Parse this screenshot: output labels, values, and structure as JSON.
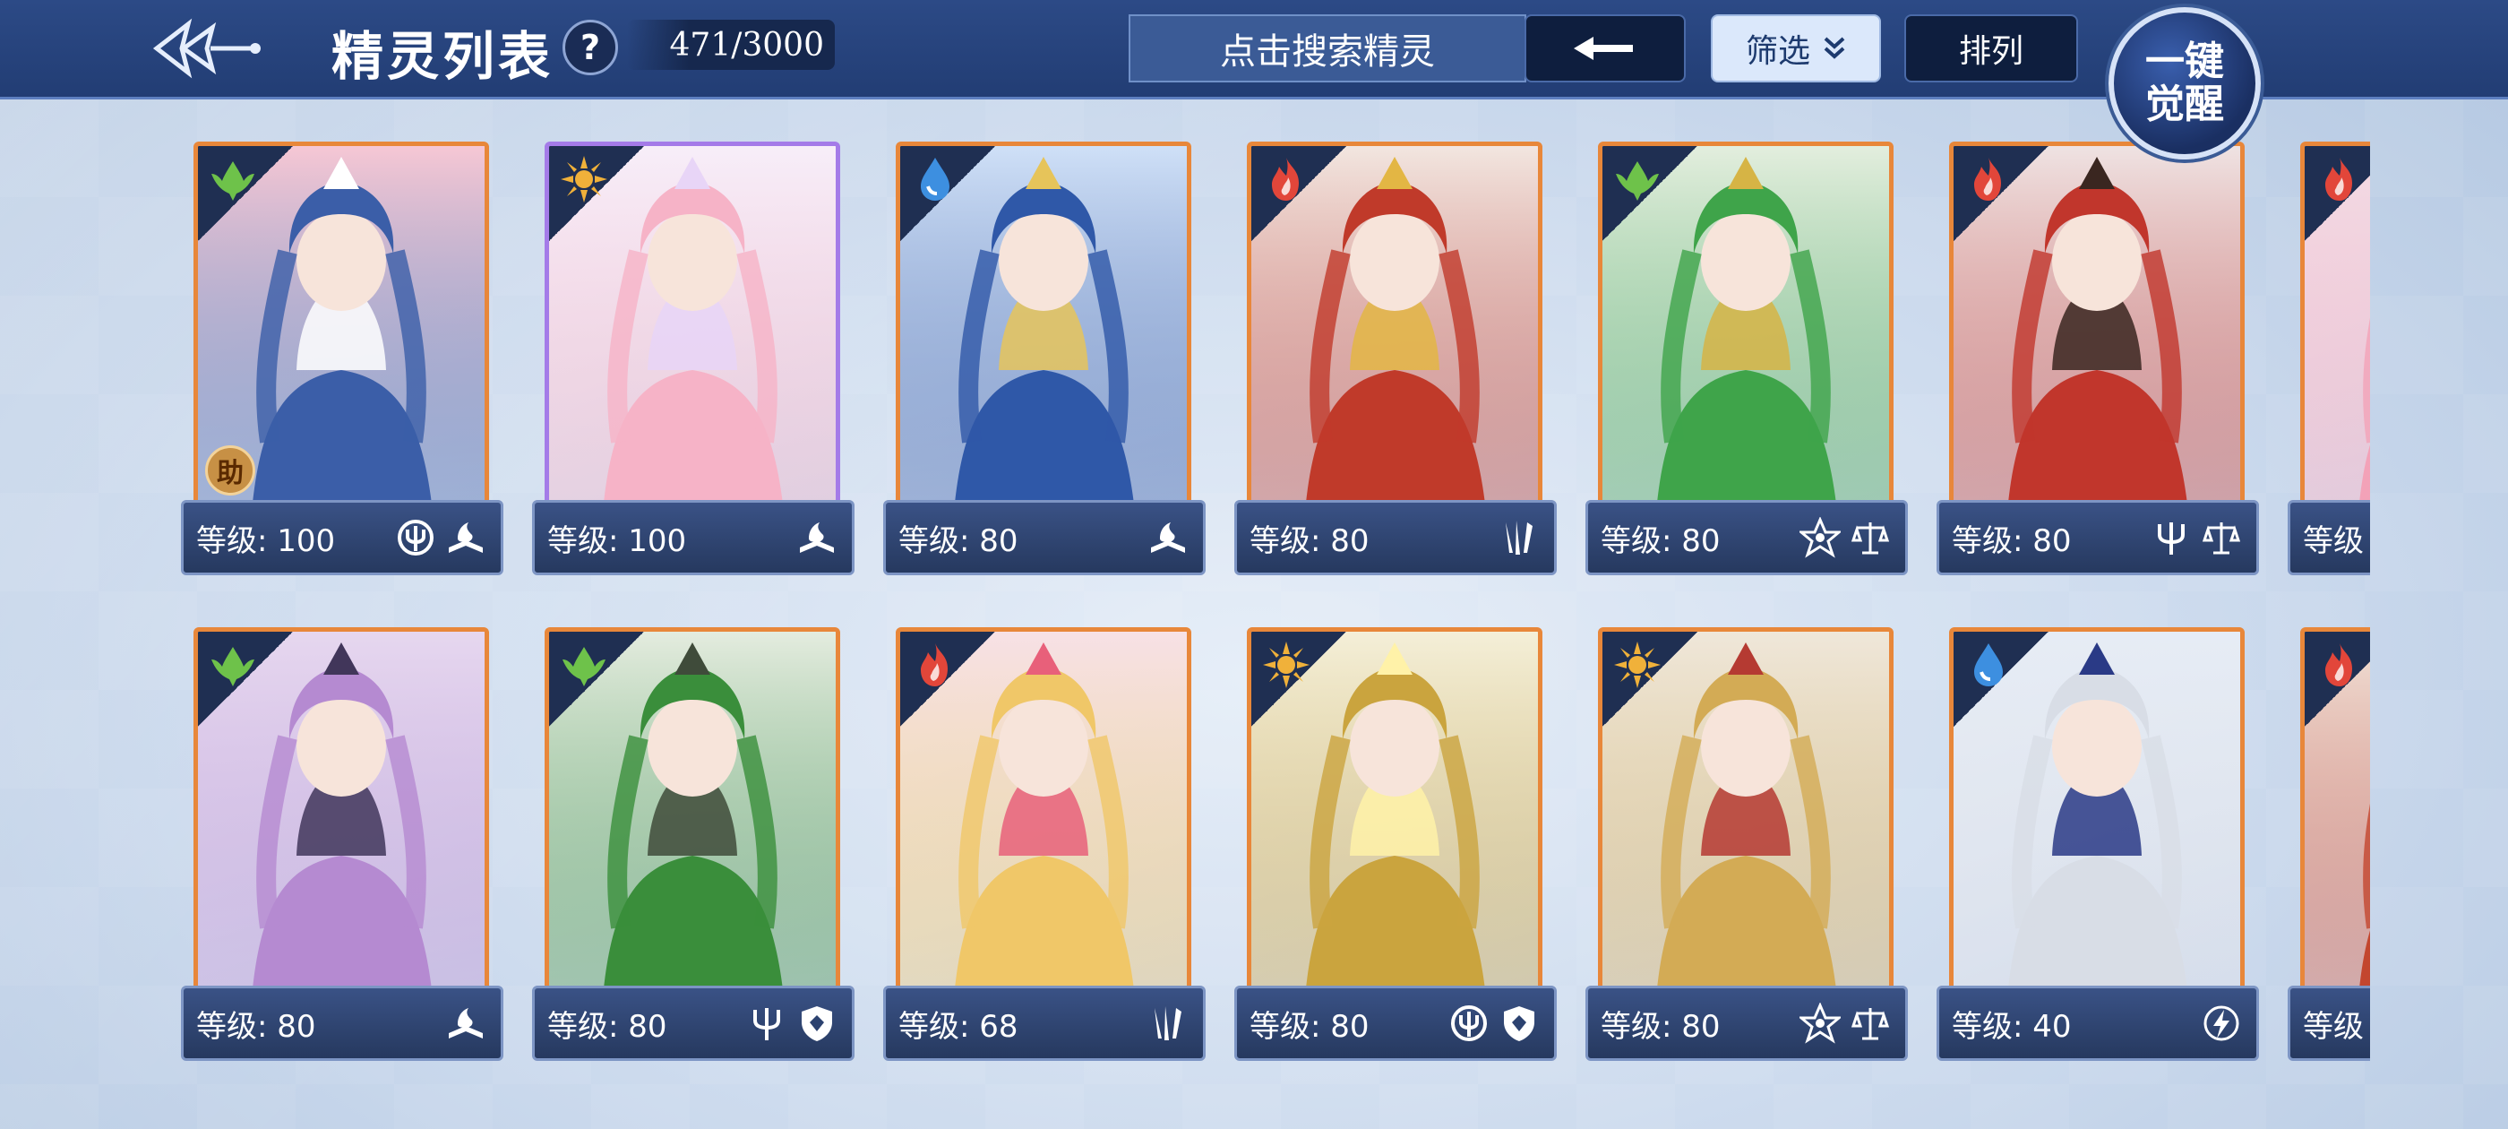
{
  "header": {
    "title": "精灵列表",
    "help_label": "?",
    "count": "471/3000",
    "search_placeholder": "点击搜索精灵",
    "filter_label": "筛选",
    "sort_label": "排列",
    "awaken_line1": "一键",
    "awaken_line2": "觉醒"
  },
  "colors": {
    "topbar": "#223d74",
    "card_border_orange": "#e8873a",
    "card_border_purple": "#a47be8",
    "grass": "#6ec24a",
    "light": "#f0b13a",
    "water": "#3d8fe0",
    "fire": "#e2463a"
  },
  "cards": [
    {
      "level": "等级: 100",
      "element": "grass",
      "traits": [
        "trident-shield-icon",
        "book-icon"
      ],
      "assist": "助",
      "theme": "pink-girl"
    },
    {
      "level": "等级: 100",
      "element": "light",
      "traits": [
        "book-icon"
      ],
      "theme": "white-fox",
      "border": "purple"
    },
    {
      "level": "等级: 80",
      "element": "water",
      "traits": [
        "book-icon"
      ],
      "theme": "blue-dragon"
    },
    {
      "level": "等级: 80",
      "element": "fire",
      "traits": [
        "claw-icon"
      ],
      "theme": "red-wolf"
    },
    {
      "level": "等级: 80",
      "element": "grass",
      "traits": [
        "star-emblem-icon",
        "scales-icon"
      ],
      "theme": "green-lord"
    },
    {
      "level": "等级: 80",
      "element": "fire",
      "traits": [
        "trident-icon",
        "scales-icon"
      ],
      "theme": "red-demon"
    },
    {
      "level": "等级",
      "element": "fire",
      "traits": [],
      "theme": "partial-pink"
    },
    {
      "level": "等级: 80",
      "element": "grass",
      "traits": [
        "book-icon"
      ],
      "theme": "purple-girl"
    },
    {
      "level": "等级: 80",
      "element": "grass",
      "traits": [
        "trident-icon",
        "shield-icon"
      ],
      "theme": "green-warrior"
    },
    {
      "level": "等级: 68",
      "element": "fire",
      "traits": [
        "claw-icon"
      ],
      "theme": "blonde-girl"
    },
    {
      "level": "等级: 80",
      "element": "light",
      "traits": [
        "trident-shield-icon",
        "shield-icon"
      ],
      "theme": "gold-dragon"
    },
    {
      "level": "等级: 80",
      "element": "light",
      "traits": [
        "star-emblem-icon",
        "scales-icon"
      ],
      "theme": "gold-king"
    },
    {
      "level": "等级: 40",
      "element": "water",
      "traits": [
        "lightning-icon"
      ],
      "theme": "silver-elf"
    },
    {
      "level": "等级",
      "element": "fire",
      "traits": [],
      "theme": "partial-red"
    }
  ]
}
